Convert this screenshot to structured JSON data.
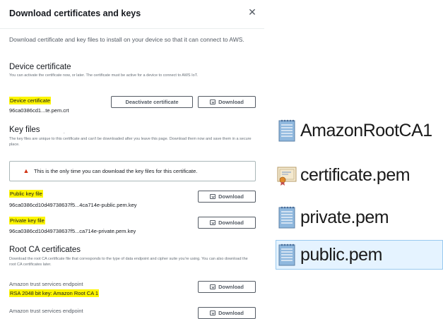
{
  "dialog": {
    "title": "Download certificates and keys",
    "intro": "Download certificate and key files to install on your device so that it can connect to AWS.",
    "device_certificate": {
      "heading": "Device certificate",
      "description": "You can activate the certificate now, or later. The certificate must be active for a device to connect to AWS IoT.",
      "label": "Device certificate",
      "value": "96ca0386cd1...te.pem.crt",
      "deactivate_label": "Deactivate certificate",
      "download_label": "Download"
    },
    "key_files": {
      "heading": "Key files",
      "dot": ".",
      "description": "The key files are unique to this certificate and can't be downloaded after you leave this page. Download them now and save them in a secure place.",
      "alert": "This is the only time you can download the key files for this certificate.",
      "public_label": "Public key file",
      "public_value": "96ca0386cd10d49738637f5...4ca714e-public.pem.key",
      "public_download": "Download",
      "private_label": "Private key file",
      "private_value": "96ca0386cd10d49738637f5...ca714e-private.pem.key",
      "private_download": "Download"
    },
    "root_ca": {
      "heading": "Root CA certificates",
      "description": "Download the root CA certificate file that corresponds to the type of data endpoint and cipher suite you're using. You can also download the root CA certificates later.",
      "endpoint1": "Amazon trust services endpoint",
      "key1": "RSA 2048 bit key: Amazon Root CA 1",
      "download1": "Download",
      "endpoint2": "Amazon trust services endpoint",
      "download2": "Download"
    }
  },
  "files": [
    {
      "name": "AmazonRootCA1",
      "icon": "text-file-icon"
    },
    {
      "name": "certificate.pem",
      "icon": "certificate-file-icon"
    },
    {
      "name": "private.pem",
      "icon": "text-file-icon"
    },
    {
      "name": "public.pem",
      "icon": "text-file-icon",
      "selected": true
    }
  ],
  "colors": {
    "highlight": "#fdf500",
    "alert_icon": "#d13212",
    "selection": "#e5f3ff"
  }
}
